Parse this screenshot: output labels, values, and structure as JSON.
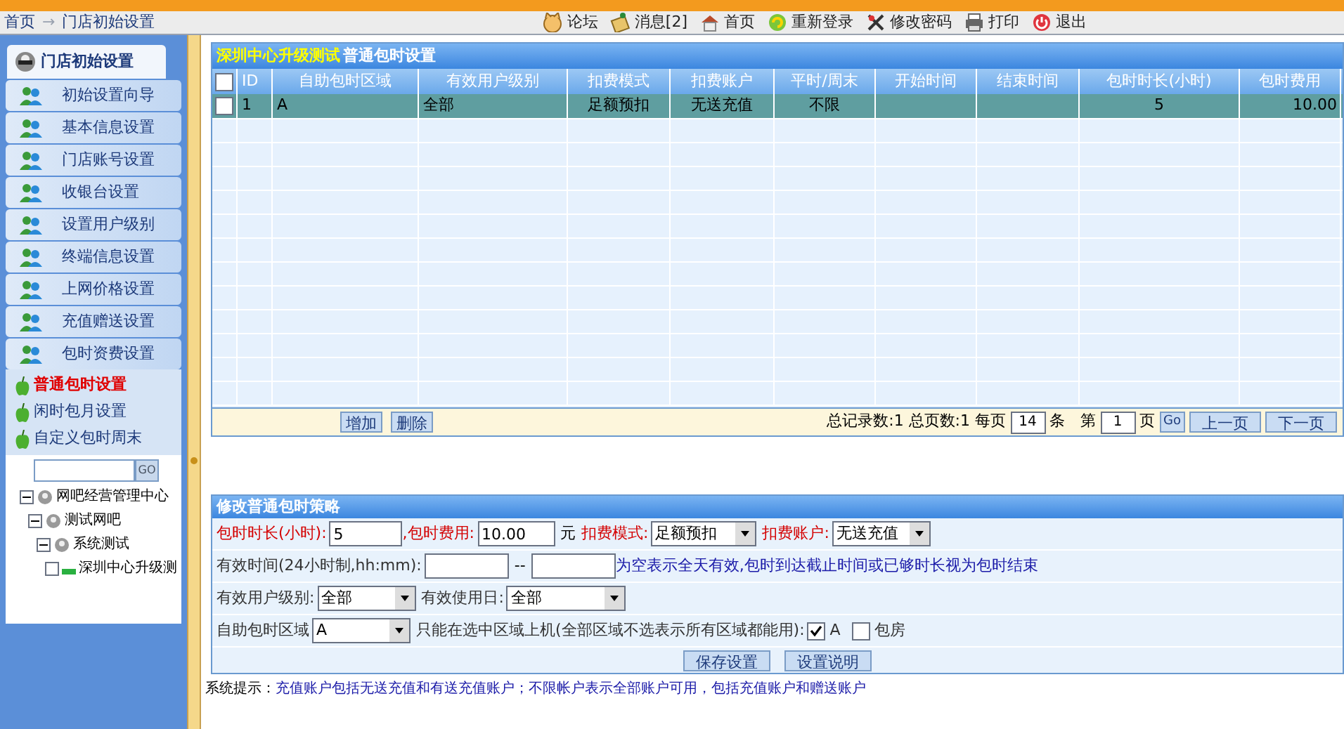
{
  "breadcrumb": [
    {
      "label": "首页"
    },
    {
      "label": "→"
    },
    {
      "label": "门店初始设置"
    }
  ],
  "toolbar": [
    {
      "label": "论坛"
    },
    {
      "label": "消息[2]"
    },
    {
      "label": "首页"
    },
    {
      "label": "重新登录"
    },
    {
      "label": "修改密码"
    },
    {
      "label": "打印"
    },
    {
      "label": "退出"
    }
  ],
  "sidebar": {
    "title": "门店初始设置",
    "items": [
      {
        "label": "初始设置向导"
      },
      {
        "label": "基本信息设置"
      },
      {
        "label": "门店账号设置"
      },
      {
        "label": "收银台设置"
      },
      {
        "label": "设置用户级别"
      },
      {
        "label": "终端信息设置"
      },
      {
        "label": "上网价格设置"
      },
      {
        "label": "充值赠送设置"
      },
      {
        "label": "包时资费设置"
      }
    ],
    "subitems": [
      {
        "label": "普通包时设置",
        "selected": true
      },
      {
        "label": "闲时包月设置",
        "selected": false
      },
      {
        "label": "自定义包时周末",
        "selected": false
      }
    ],
    "tree_search": {
      "button": "GO"
    },
    "tree": [
      {
        "label": "网吧经营管理中心",
        "expanded": true,
        "children": [
          {
            "label": "测试网吧",
            "expanded": true,
            "children": [
              {
                "label": "系统测试",
                "expanded": true,
                "children": [
                  {
                    "label": "深圳中心升级测",
                    "expanded": false
                  }
                ]
              }
            ]
          }
        ]
      }
    ]
  },
  "table": {
    "title_highlight": "深圳中心升级测试",
    "title": "普通包时设置",
    "select_all_checked": false,
    "columns": [
      "ID",
      "自助包时区域",
      "有效用户级别",
      "扣费模式",
      "扣费账户",
      "平时/周末",
      "开始时间",
      "结束时间",
      "包时时长(小时)",
      "包时费用"
    ],
    "rows": [
      {
        "selected": true,
        "checked": false,
        "cells": [
          "1",
          "A",
          "全部",
          "足额预扣",
          "无送充值",
          "不限",
          "",
          "",
          "5",
          "10.00"
        ]
      }
    ],
    "buttons": [
      "增加",
      "删除"
    ],
    "pager": {
      "summary": "总记录数:1 总页数:1 每页",
      "per_page": "14",
      "per_page_unit": "条",
      "page_prefix": "第",
      "page": "1",
      "page_suffix": "页",
      "go": "Go",
      "prev": "上一页",
      "next": "下一页"
    }
  },
  "form": {
    "title": "修改普通包时策略",
    "rows": [
      [
        {
          "kind": "label",
          "text": "包时时长(小时):",
          "required": true
        },
        {
          "kind": "input",
          "value": "5"
        },
        {
          "kind": "label",
          "text": ",包时费用:",
          "required": true
        },
        {
          "kind": "input",
          "value": "10.00"
        },
        {
          "kind": "text",
          "text": "元"
        },
        {
          "kind": "label",
          "text": "扣费模式:",
          "required": true
        },
        {
          "kind": "select",
          "value": "足额预扣"
        },
        {
          "kind": "label",
          "text": "扣费账户:",
          "required": true
        },
        {
          "kind": "select",
          "value": "无送充值"
        }
      ],
      [
        {
          "kind": "label",
          "text": "有效时间(24小时制,hh:mm):",
          "required": false
        },
        {
          "kind": "input"
        },
        {
          "kind": "text",
          "text": "--"
        },
        {
          "kind": "input"
        },
        {
          "kind": "note",
          "text": "为空表示全天有效,包时到达截止时间或已够时长视为包时结束"
        }
      ],
      [
        {
          "kind": "label",
          "text": "有效用户级别:",
          "required": false
        },
        {
          "kind": "select",
          "value": "全部"
        },
        {
          "kind": "label",
          "text": "有效使用日:",
          "required": false
        },
        {
          "kind": "select",
          "value": "全部"
        }
      ],
      [
        {
          "kind": "label",
          "text": "自助包时区域",
          "required": false
        },
        {
          "kind": "select",
          "value": "A"
        },
        {
          "kind": "label",
          "text": "只能在选中区域上机(全部区域不选表示所有区域都能用):",
          "required": false
        },
        {
          "kind": "checkbox",
          "text": "A",
          "checked": true
        },
        {
          "kind": "checkbox",
          "text": "包房",
          "checked": false
        }
      ]
    ],
    "buttons": [
      "保存设置",
      "设置说明"
    ]
  },
  "hint": {
    "label": "系统提示：",
    "text": "充值账户包括无送充值和有送充值账户；不限帐户表示全部账户可用，包括充值账户和赠送账户"
  }
}
